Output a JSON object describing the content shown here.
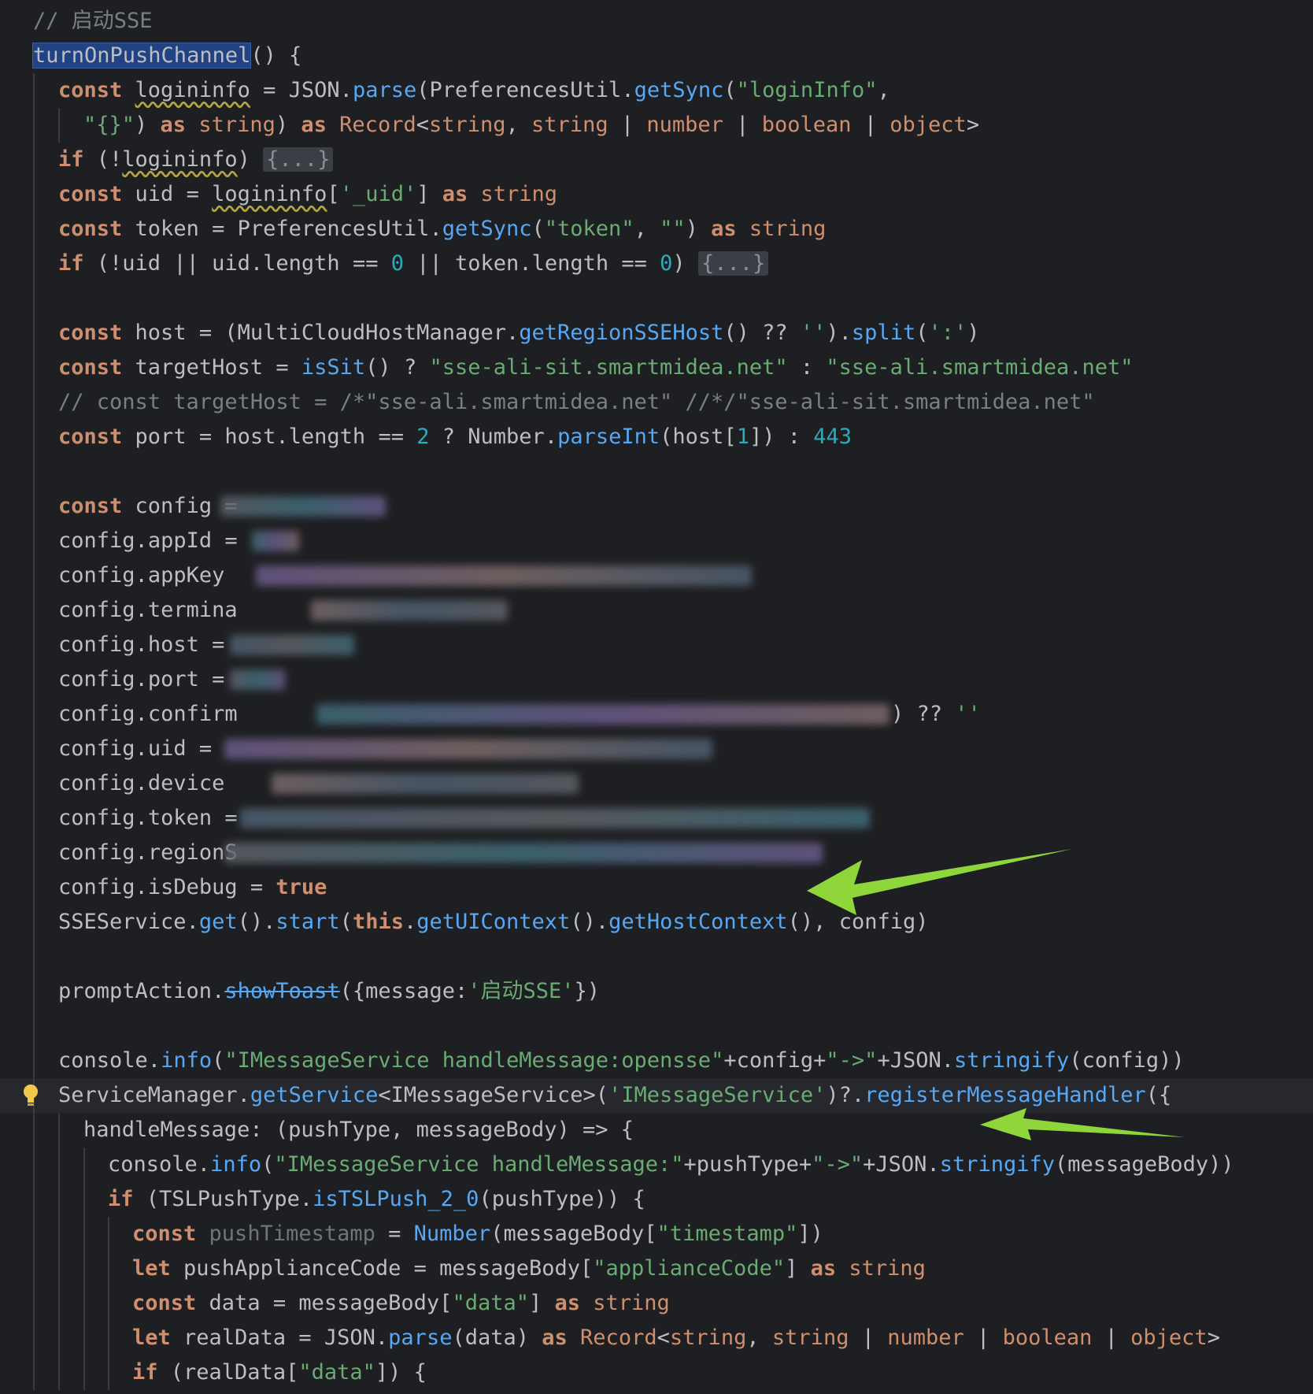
{
  "editor": {
    "lines": [
      "// 启动SSE",
      "turnOnPushChannel() {",
      "const logininfo = JSON.parse(PreferencesUtil.getSync(\"loginInfo\",",
      "\"{}\") as string) as Record<string, string | number | boolean | object>",
      "if (!logininfo) {...}",
      "const uid = logininfo['_uid'] as string",
      "const token = PreferencesUtil.getSync(\"token\", \"\") as string",
      "if (!uid || uid.length == 0 || token.length == 0) {...}",
      "",
      "const host = (MultiCloudHostManager.getRegionSSEHost() ?? '').split(':')",
      "const targetHost = isSit() ? \"sse-ali-sit.smartmidea.net\" : \"sse-ali.smartmidea.net\"",
      "// const targetHost = /*\"sse-ali.smartmidea.net\" //*/\"sse-ali-sit.smartmidea.net\"",
      "const port = host.length == 2 ? Number.parseInt(host[1]) : 443",
      "",
      "const config =",
      "config.appId =",
      "config.appKey",
      "config.termina",
      "config.host =",
      "config.port =",
      "config.confirm",
      "config.uid =",
      "config.device",
      "config.token =",
      "config.regionS",
      "config.isDebug = true",
      "SSEService.get().start(this.getUIContext().getHostContext(), config)",
      "",
      "promptAction.showToast({message:'启动SSE'})",
      "",
      "console.info(\"IMessageService handleMessage:opensse\"+config+\"->\"+JSON.stringify(config))",
      "ServiceManager.getService<IMessageService>('IMessageService')?.registerMessageHandler({",
      "handleMessage: (pushType, messageBody) => {",
      "console.info(\"IMessageService handleMessage:\"+pushType+\"->\"+JSON.stringify(messageBody))",
      "if (TSLPushType.isTSLPush_2_0(pushType)) {",
      "const pushTimestamp = Number(messageBody[\"timestamp\"])",
      "let pushApplianceCode = messageBody[\"applianceCode\"] as string",
      "const data = messageBody[\"data\"] as string",
      "let realData = JSON.parse(data) as Record<string, string | number | boolean | object>",
      "if (realData[\"data\"]) {"
    ],
    "tail_fragments": {
      "confirm_tail": ") ?? ''"
    },
    "colors": {
      "background": "#1e1f22",
      "keyword": "#cf8e6d",
      "function": "#56a8f5",
      "string": "#6aab73",
      "number": "#2aacb8",
      "comment": "#7a7e85",
      "arrow": "#8fd63a"
    },
    "icons": [
      "lightbulb-icon",
      "arrow-annotation-icon"
    ]
  }
}
